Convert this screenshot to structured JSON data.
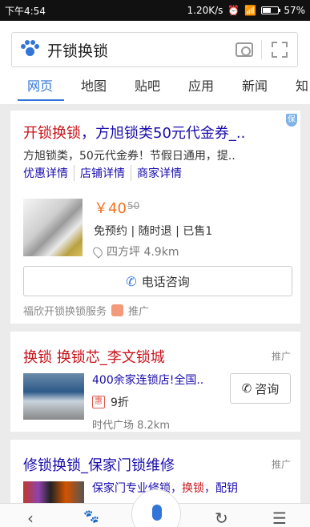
{
  "status_bar": {
    "time": "下午4:54",
    "speed": "1.20K/s",
    "battery": "57%",
    "battery_level": 0.57
  },
  "search": {
    "query": "开锁换锁"
  },
  "tabs": [
    {
      "label": "网页",
      "active": true
    },
    {
      "label": "地图"
    },
    {
      "label": "贴吧"
    },
    {
      "label": "应用"
    },
    {
      "label": "新闻"
    },
    {
      "label": "知"
    }
  ],
  "result1": {
    "title_part1": "开锁换锁",
    "title_part2": "，方旭锁类50元代金券_..",
    "description": "方旭锁类，50元代金券！节假日通用，提..",
    "sublinks": [
      "优惠详情",
      "店铺详情",
      "商家详情"
    ],
    "badge": "保",
    "price": "￥40",
    "price_old": "50",
    "tags": "免预约 | 随时退 | 已售1",
    "location": "四方坪 4.9km",
    "phone_button": "电话咨询",
    "source": "福欣开锁换锁服务",
    "promo": "推广"
  },
  "result2": {
    "title": "换锁 换锁芯_李文锁城",
    "promo": "推广",
    "line1": "400余家连锁店!全国..",
    "discount_badge": "惠",
    "discount": "9折",
    "location": "时代广场 8.2km",
    "consult_button": "咨询"
  },
  "result3": {
    "title": "修锁换锁_保家门锁维修",
    "promo": "推广",
    "line1_a": "保家门专业修锁，",
    "line1_b": "换锁",
    "line1_c": "，配钥"
  },
  "colors": {
    "accent": "#3275d8",
    "title_red": "#c8131b",
    "link_blue": "#1a0dab",
    "price_orange": "#f26f1f"
  }
}
